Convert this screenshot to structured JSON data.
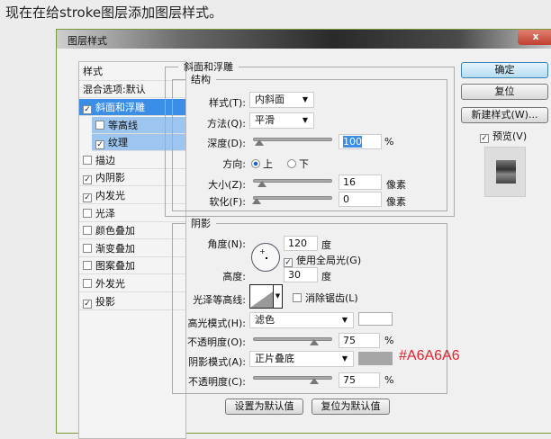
{
  "caption": "现在在给stroke图层添加图层样式。",
  "dialog": {
    "title": "图层样式",
    "close": "x"
  },
  "list": {
    "header": "样式",
    "blend": "混合选项:默认",
    "items": [
      {
        "label": "斜面和浮雕",
        "checked": true
      },
      {
        "label": "等高线",
        "checked": false
      },
      {
        "label": "纹理",
        "checked": true
      },
      {
        "label": "描边",
        "checked": false
      },
      {
        "label": "内阴影",
        "checked": true
      },
      {
        "label": "内发光",
        "checked": true
      },
      {
        "label": "光泽",
        "checked": false
      },
      {
        "label": "颜色叠加",
        "checked": false
      },
      {
        "label": "渐变叠加",
        "checked": false
      },
      {
        "label": "图案叠加",
        "checked": false
      },
      {
        "label": "外发光",
        "checked": false
      },
      {
        "label": "投影",
        "checked": true
      }
    ]
  },
  "bevel": {
    "legend": "斜面和浮雕",
    "structure": "结构",
    "style_label": "样式(T):",
    "style": "内斜面",
    "method_label": "方法(Q):",
    "method": "平滑",
    "depth_label": "深度(D):",
    "depth": "100",
    "pct": "%",
    "dir_label": "方向:",
    "up": "上",
    "down": "下",
    "size_label": "大小(Z):",
    "size": "16",
    "soften_label": "软化(F):",
    "soften": "0",
    "px": "像素"
  },
  "shading": {
    "legend": "阴影",
    "angle_label": "角度(N):",
    "angle": "120",
    "deg": "度",
    "global": "使用全局光(G)",
    "alt_label": "高度:",
    "alt": "30",
    "gloss_label": "光泽等高线:",
    "anti": "消除锯齿(L)",
    "hl_label": "高光模式(H):",
    "hl_mode": "滤色",
    "op1_label": "不透明度(O):",
    "op1": "75",
    "sh_label": "阴影模式(A):",
    "sh_mode": "正片叠底",
    "op2_label": "不透明度(C):",
    "op2": "75",
    "sh_color": "#A6A6A6",
    "hl_color": "#FFFFFF",
    "annotation": "#A6A6A6"
  },
  "buttons": {
    "ok": "确定",
    "reset": "复位",
    "new_style": "新建样式(W)...",
    "preview": "预览(V)",
    "make_default": "设置为默认值",
    "reset_default": "复位为默认值"
  }
}
